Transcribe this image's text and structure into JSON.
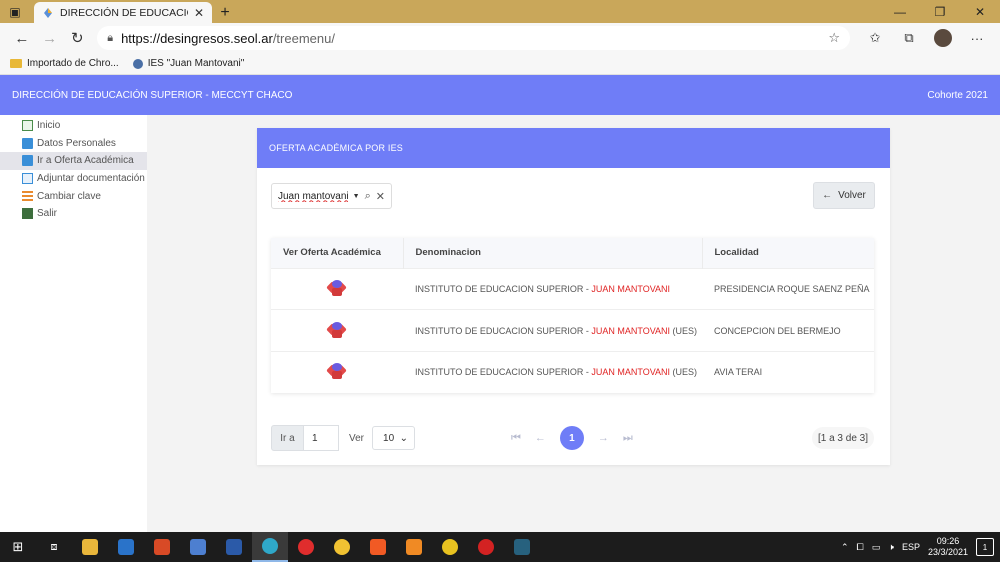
{
  "browser": {
    "tab_title": "DIRECCIÓN DE EDUCACIÓN SUP",
    "url_host": "https://desingresos.seol.ar",
    "url_path": "/treemenu/",
    "bookmarks": [
      "Importado de Chro...",
      "IES \"Juan Mantovani\""
    ]
  },
  "header": {
    "title": "DIRECCIÓN DE EDUCACIÓN SUPERIOR - MECCYT CHACO",
    "cohort": "Cohorte 2021"
  },
  "sidebar": {
    "items": [
      {
        "label": "Inicio",
        "icon": "home-icon"
      },
      {
        "label": "Datos Personales",
        "icon": "id-card-icon"
      },
      {
        "label": "Ir a Oferta Académica",
        "icon": "list-icon",
        "active": true
      },
      {
        "label": "Adjuntar documentación",
        "icon": "edit-icon"
      },
      {
        "label": "Cambiar clave",
        "icon": "key-icon"
      },
      {
        "label": "Salir",
        "icon": "exit-icon"
      }
    ]
  },
  "panel": {
    "title": "OFERTA ACADÉMICA POR IES",
    "search_value": "Juan mantovani",
    "back_label": "Volver"
  },
  "table": {
    "headers": [
      "Ver Oferta Académica",
      "Denominacion",
      "Localidad"
    ],
    "rows": [
      {
        "prefix": "INSTITUTO DE EDUCACION SUPERIOR - ",
        "highlight": "JUAN MANTOVANI",
        "suffix": "",
        "localidad": "PRESIDENCIA ROQUE SAENZ PEÑA"
      },
      {
        "prefix": "INSTITUTO DE EDUCACION SUPERIOR - ",
        "highlight": "JUAN MANTOVANI",
        "suffix": " (UES)",
        "localidad": "CONCEPCION DEL BERMEJO"
      },
      {
        "prefix": "INSTITUTO DE EDUCACION SUPERIOR - ",
        "highlight": "JUAN MANTOVANI",
        "suffix": " (UES)",
        "localidad": "AVIA TERAI"
      }
    ]
  },
  "pager": {
    "goto_label": "Ir a",
    "goto_value": "1",
    "ver_label": "Ver",
    "page_size": "10",
    "current_page": "1",
    "info": "[1 a 3 de 3]"
  },
  "taskbar": {
    "lang": "ESP",
    "time": "09:26",
    "date": "23/3/2021",
    "notifications": "1"
  },
  "colors": {
    "accent": "#6f7df7",
    "highlight": "#e02424"
  }
}
